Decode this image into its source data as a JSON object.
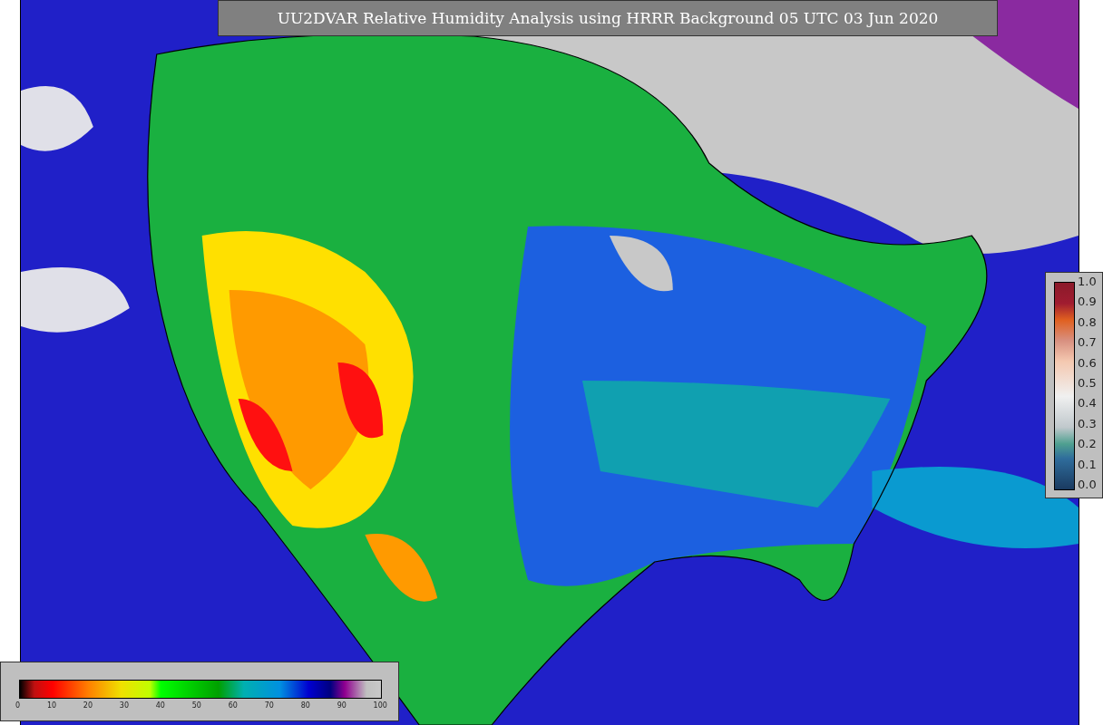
{
  "title": "UU2DVAR Relative Humidity Analysis using HRRR Background 05 UTC 03 Jun 2020",
  "observation_colorbar": {
    "ticks": [
      "1.0",
      "0.9",
      "0.8",
      "0.7",
      "0.6",
      "0.5",
      "0.4",
      "0.3",
      "0.2",
      "0.1",
      "0.0"
    ]
  },
  "humidity_colorbar": {
    "ticks": [
      "0",
      "10",
      "20",
      "30",
      "40",
      "50",
      "60",
      "70",
      "80",
      "90",
      "100"
    ]
  }
}
